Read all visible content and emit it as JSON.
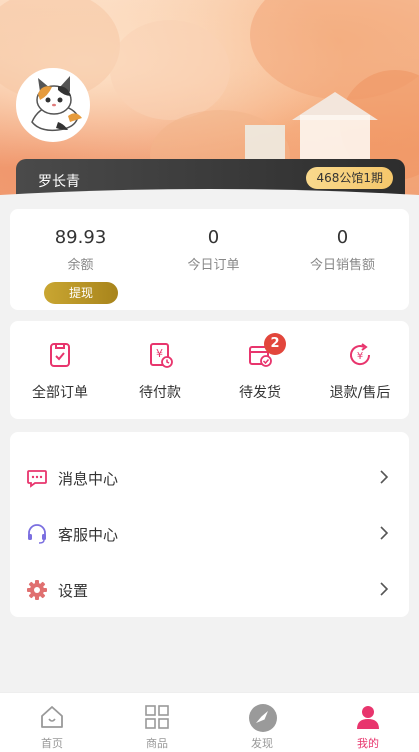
{
  "profile": {
    "name": "罗长青",
    "level": "468公馆1期"
  },
  "stats": [
    {
      "value": "89.93",
      "label": "余额"
    },
    {
      "value": "0",
      "label": "今日订单"
    },
    {
      "value": "0",
      "label": "今日销售额"
    }
  ],
  "withdraw_label": "提现",
  "orders": [
    {
      "label": "全部订单",
      "icon": "all-orders-icon"
    },
    {
      "label": "待付款",
      "icon": "pending-payment-icon"
    },
    {
      "label": "待发货",
      "icon": "pending-shipment-icon",
      "badge": "2"
    },
    {
      "label": "退款/售后",
      "icon": "refund-icon"
    }
  ],
  "menu": [
    {
      "label": "消息中心",
      "icon": "message-icon"
    },
    {
      "label": "客服中心",
      "icon": "headset-icon"
    },
    {
      "label": "设置",
      "icon": "gear-icon"
    }
  ],
  "tabs": [
    {
      "label": "首页",
      "icon": "home-icon"
    },
    {
      "label": "商品",
      "icon": "grid-icon"
    },
    {
      "label": "发现",
      "icon": "compass-icon"
    },
    {
      "label": "我的",
      "icon": "user-icon",
      "active": true
    }
  ],
  "colors": {
    "accent": "#e8356d",
    "badge": "#e2463c",
    "gold": "#c9a632"
  }
}
